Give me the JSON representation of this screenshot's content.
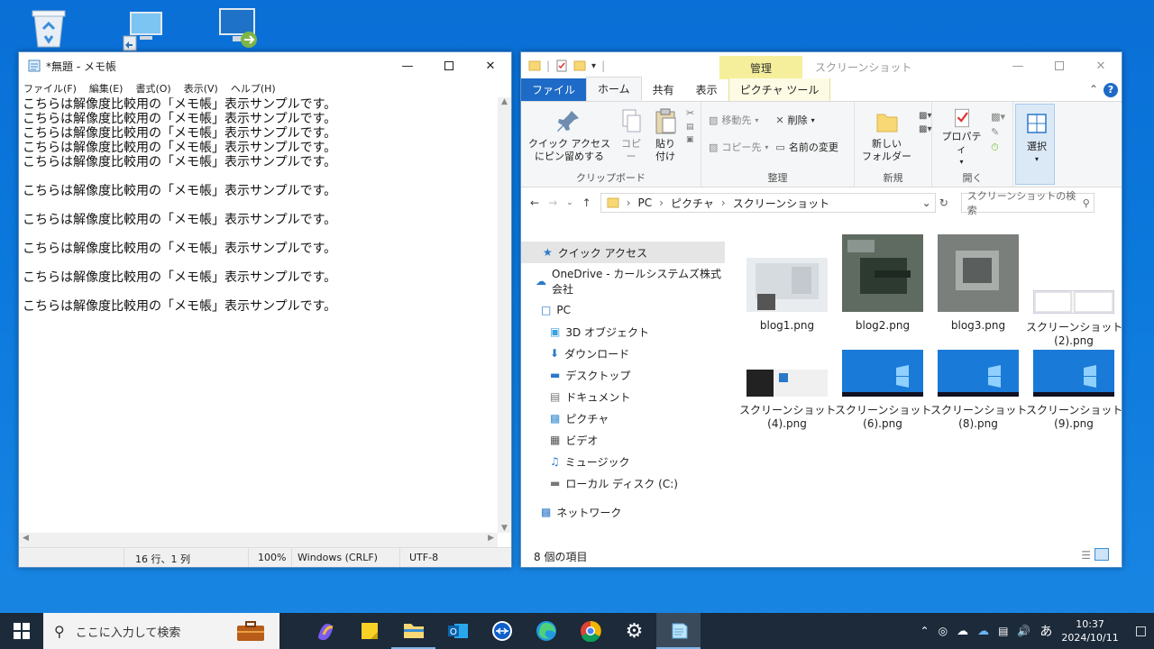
{
  "desktop": {
    "icons": [
      "recycle-bin-icon",
      "pc-icon",
      "remote-desktop-icon"
    ]
  },
  "notepad": {
    "title": "*無題 - メモ帳",
    "menu": [
      "ファイル(F)",
      "編集(E)",
      "書式(O)",
      "表示(V)",
      "ヘルプ(H)"
    ],
    "text": "こちらは解像度比較用の「メモ帳」表示サンプルです。\nこちらは解像度比較用の「メモ帳」表示サンプルです。\nこちらは解像度比較用の「メモ帳」表示サンプルです。\nこちらは解像度比較用の「メモ帳」表示サンプルです。\nこちらは解像度比較用の「メモ帳」表示サンプルです。\n\nこちらは解像度比較用の「メモ帳」表示サンプルです。\n\nこちらは解像度比較用の「メモ帳」表示サンプルです。\n\nこちらは解像度比較用の「メモ帳」表示サンプルです。\n\nこちらは解像度比較用の「メモ帳」表示サンプルです。\n\nこちらは解像度比較用の「メモ帳」表示サンプルです。\n",
    "status": {
      "position": "16 行、1 列",
      "zoom": "100%",
      "line_ending": "Windows (CRLF)",
      "encoding": "UTF-8"
    }
  },
  "explorer": {
    "manage_tab": "管理",
    "title": "スクリーンショット",
    "tabs": [
      "ファイル",
      "ホーム",
      "共有",
      "表示",
      "ピクチャ ツール"
    ],
    "ribbon": {
      "clipboard": {
        "pin": "クイック アクセス\nにピン留めする",
        "copy": "コピー",
        "paste": "貼り付け",
        "label": "クリップボード"
      },
      "organize": {
        "move": "移動先",
        "copy_to": "コピー先",
        "delete": "削除",
        "rename": "名前の変更",
        "label": "整理"
      },
      "new": {
        "new_folder": "新しい\nフォルダー",
        "label": "新規"
      },
      "open": {
        "properties": "プロパティ",
        "label": "開く"
      },
      "select": {
        "select": "選択"
      }
    },
    "address": [
      "PC",
      "ピクチャ",
      "スクリーンショット"
    ],
    "search_placeholder": "スクリーンショットの検索",
    "nav": {
      "quick_access": "クイック アクセス",
      "onedrive": "OneDrive - カールシステムズ株式会社",
      "pc": "PC",
      "items": [
        "3D オブジェクト",
        "ダウンロード",
        "デスクトップ",
        "ドキュメント",
        "ピクチャ",
        "ビデオ",
        "ミュージック",
        "ローカル ディスク (C:)"
      ],
      "network": "ネットワーク"
    },
    "files": [
      {
        "name": "blog1.png"
      },
      {
        "name": "blog2.png"
      },
      {
        "name": "blog3.png"
      },
      {
        "name": "スクリーンショット\n(2).png"
      },
      {
        "name": "スクリーンショット\n(4).png"
      },
      {
        "name": "スクリーンショット\n(6).png"
      },
      {
        "name": "スクリーンショット\n(8).png"
      },
      {
        "name": "スクリーンショット\n(9).png"
      }
    ],
    "status": "8 個の項目"
  },
  "taskbar": {
    "search_placeholder": "ここに入力して検索",
    "ime": "あ",
    "time": "10:37",
    "date": "2024/10/11"
  }
}
